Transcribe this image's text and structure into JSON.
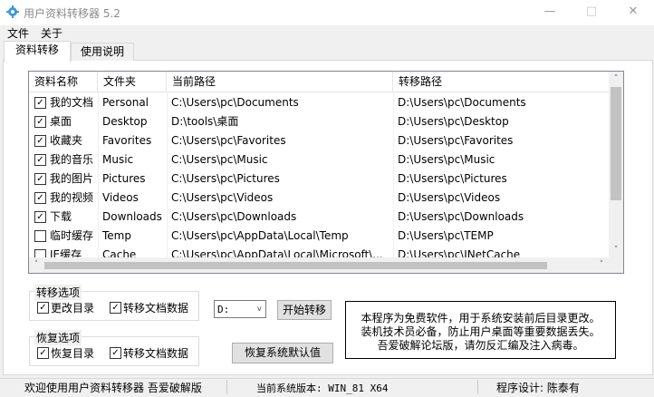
{
  "window": {
    "title": "用户资料转移器 5.2",
    "minimize_icon": "minimize-icon",
    "maximize_icon": "maximize-icon",
    "close_icon": "close-icon"
  },
  "menu": {
    "file": "文件",
    "about": "关于"
  },
  "tabs": [
    {
      "label": "资料转移",
      "active": true
    },
    {
      "label": "使用说明",
      "active": false
    }
  ],
  "list": {
    "columns": [
      "资料名称",
      "文件夹",
      "当前路径",
      "转移路径"
    ],
    "rows": [
      {
        "checked": true,
        "name": "我的文档",
        "folder": "Personal",
        "current": "C:\\Users\\pc\\Documents",
        "target": "D:\\Users\\pc\\Documents"
      },
      {
        "checked": true,
        "name": "桌面",
        "folder": "Desktop",
        "current": "D:\\tools\\桌面",
        "target": "D:\\Users\\pc\\Desktop"
      },
      {
        "checked": true,
        "name": "收藏夹",
        "folder": "Favorites",
        "current": "C:\\Users\\pc\\Favorites",
        "target": "D:\\Users\\pc\\Favorites"
      },
      {
        "checked": true,
        "name": "我的音乐",
        "folder": "Music",
        "current": "C:\\Users\\pc\\Music",
        "target": "D:\\Users\\pc\\Music"
      },
      {
        "checked": true,
        "name": "我的图片",
        "folder": "Pictures",
        "current": "C:\\Users\\pc\\Pictures",
        "target": "D:\\Users\\pc\\Pictures"
      },
      {
        "checked": true,
        "name": "我的视频",
        "folder": "Videos",
        "current": "C:\\Users\\pc\\Videos",
        "target": "D:\\Users\\pc\\Videos"
      },
      {
        "checked": true,
        "name": "下载",
        "folder": "Downloads",
        "current": "C:\\Users\\pc\\Downloads",
        "target": "D:\\Users\\pc\\Downloads"
      },
      {
        "checked": false,
        "name": "临时缓存",
        "folder": "Temp",
        "current": "C:\\Users\\pc\\AppData\\Local\\Temp",
        "target": "D:\\Users\\pc\\TEMP"
      },
      {
        "checked": false,
        "name": "IE缓存",
        "folder": "Cache",
        "current": "C:\\Users\\pc\\AppData\\Local\\Microsoft\\...",
        "target": "D:\\Users\\pc\\INetCache"
      }
    ]
  },
  "transfer_options": {
    "legend": "转移选项",
    "change_dir": {
      "label": "更改目录",
      "checked": true
    },
    "move_data": {
      "label": "转移文档数据",
      "checked": true
    }
  },
  "drive_select": {
    "value": "D:",
    "options": [
      "D:"
    ]
  },
  "start_button": "开始转移",
  "restore_options": {
    "legend": "恢复选项",
    "restore_dir": {
      "label": "恢复目录",
      "checked": true
    },
    "move_data": {
      "label": "转移文档数据",
      "checked": true
    }
  },
  "restore_default_button": "恢复系统默认值",
  "notice": [
    "本程序为免费软件，用于系统安装前后目录更改。",
    "装机技术员必备，防止用户桌面等重要数据丢失。",
    "吾爱破解论坛版，请勿反汇编及注入病毒。"
  ],
  "status": {
    "welcome": "欢迎使用用户资料转移器 吾爱破解版",
    "version": "当前系统版本: WIN_81 X64",
    "author": "程序设计: 陈泰有"
  },
  "colors": {
    "check": "#000000",
    "scroll_thumb": "#c2c2c2",
    "app_icon": "#3a9ad9"
  }
}
